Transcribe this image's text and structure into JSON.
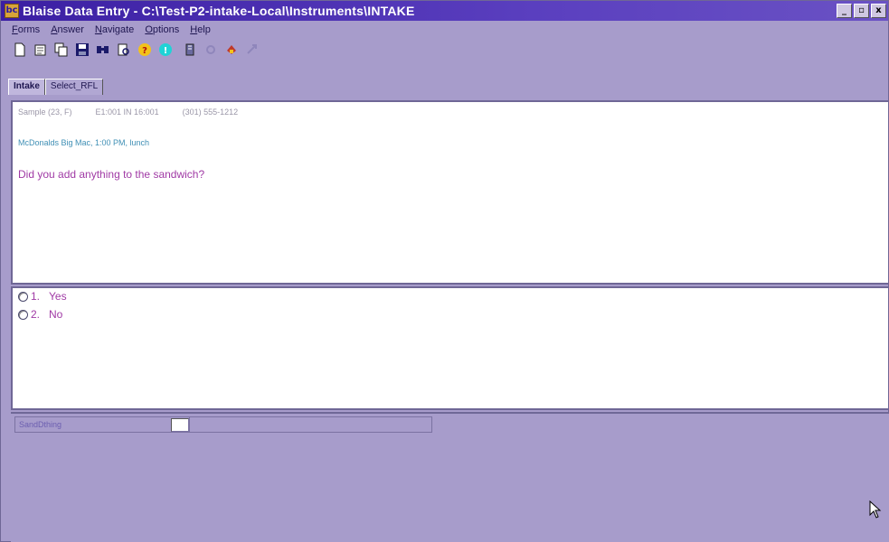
{
  "window": {
    "title": "Blaise Data Entry - C:\\Test-P2-intake-Local\\Instruments\\INTAKE",
    "app_icon": "bd-app-icon",
    "buttons": {
      "minimize": "_",
      "maximize": "▫",
      "close": "x"
    }
  },
  "menu": {
    "items": [
      {
        "first": "F",
        "rest": "orms"
      },
      {
        "first": "A",
        "rest": "nswer"
      },
      {
        "first": "N",
        "rest": "avigate"
      },
      {
        "first": "O",
        "rest": "ptions"
      },
      {
        "first": "H",
        "rest": "elp"
      }
    ]
  },
  "toolbar": {
    "icons": [
      "new-file-icon",
      "open-icon",
      "copy-icon",
      "save-icon",
      "find-icon",
      "print-preview-icon",
      "help-icon",
      "info-icon",
      "book-icon",
      "back-icon",
      "stop-icon",
      "forward-icon"
    ]
  },
  "tabs": [
    {
      "label": "Intake",
      "active": true
    },
    {
      "label": "Select_RFL",
      "active": false
    }
  ],
  "question": {
    "header": [
      "Sample (23, F)",
      "E1:001 IN 16:001",
      "(301) 555-1212"
    ],
    "context": "McDonalds Big Mac, 1:00 PM, lunch",
    "text": "Did you add anything to the sandwich?"
  },
  "answers": [
    {
      "code": "1.",
      "label": "Yes"
    },
    {
      "code": "2.",
      "label": "No"
    }
  ],
  "form": {
    "field_label": "SandDthing",
    "field_value": ""
  },
  "colors": {
    "titlebar": "#3b1fa3",
    "background": "#a79ccb",
    "question_text": "#a03aa5",
    "context_text": "#3f8fb5"
  }
}
